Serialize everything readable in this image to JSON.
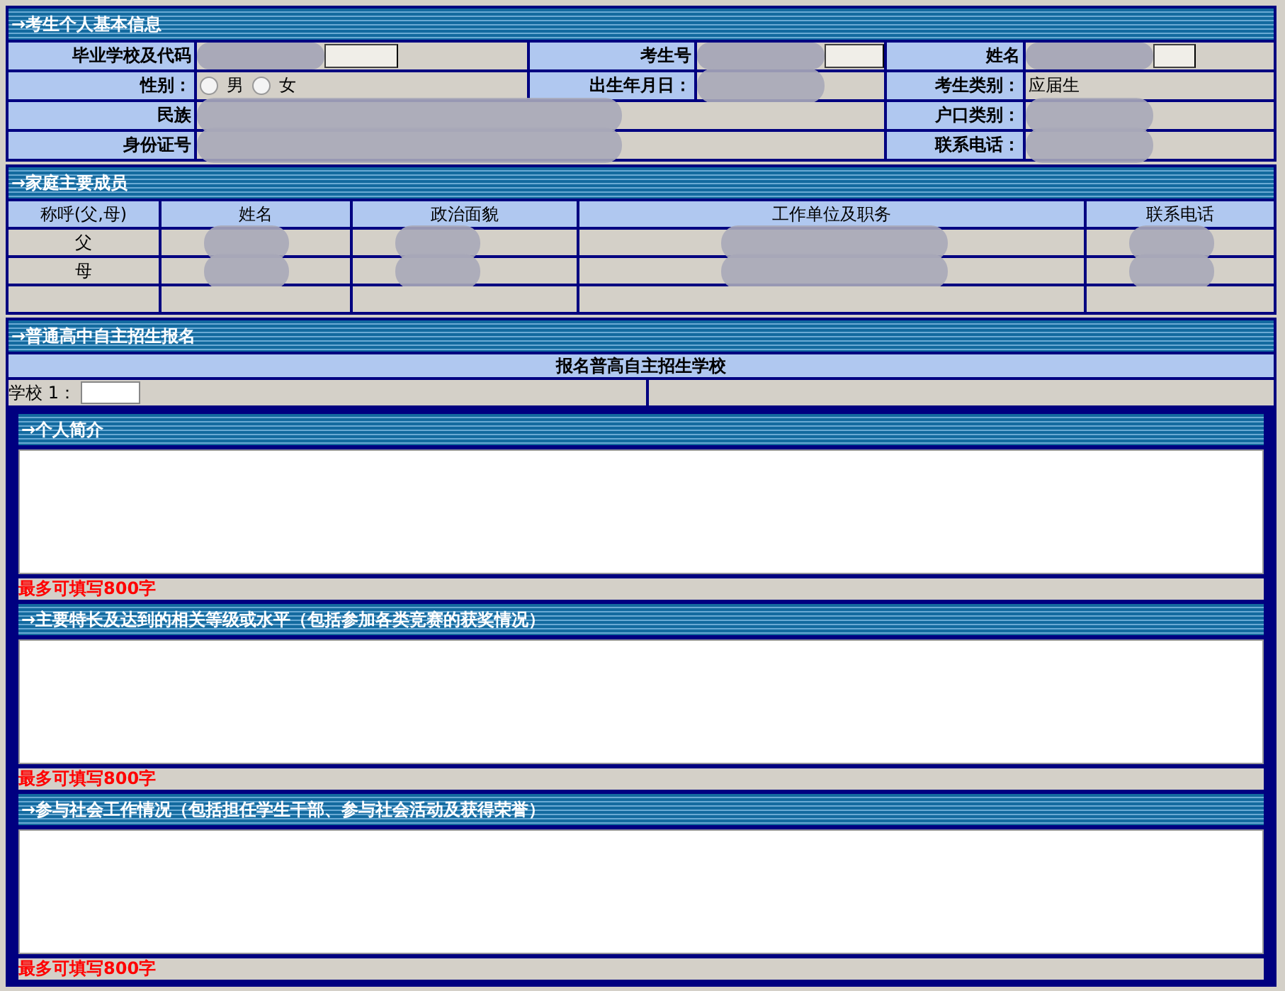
{
  "personal_info": {
    "title": "→考生个人基本信息",
    "rows": [
      {
        "cells": [
          {
            "label": "毕业学校及代码",
            "kind": "input",
            "redacted": true
          },
          {
            "label": "考生号",
            "kind": "input",
            "redacted": true
          },
          {
            "label": "姓名",
            "kind": "input",
            "redacted": true
          }
        ]
      },
      {
        "cells": [
          {
            "label": "性别：",
            "kind": "radio",
            "options": [
              {
                "label": "男",
                "selected": false
              },
              {
                "label": "女",
                "selected": false
              }
            ]
          },
          {
            "label": "出生年月日：",
            "kind": "text",
            "redacted": true
          },
          {
            "label": "考生类别：",
            "kind": "text",
            "value": "应届生"
          }
        ]
      },
      {
        "cells": [
          {
            "label": "民族",
            "kind": "wide",
            "redacted": true
          },
          {
            "label": "户口类别：",
            "kind": "text",
            "redacted": true
          }
        ]
      },
      {
        "cells": [
          {
            "label": "身份证号",
            "kind": "wide",
            "redacted": true
          },
          {
            "label": "联系电话：",
            "kind": "text",
            "redacted": true
          }
        ]
      }
    ]
  },
  "family": {
    "title": "→家庭主要成员",
    "columns": [
      "称呼(父,母)",
      "姓名",
      "政治面貌",
      "工作单位及职务",
      "联系电话"
    ],
    "rows": [
      {
        "relation": "父",
        "redacted": true
      },
      {
        "relation": "母",
        "redacted": true
      },
      {
        "relation": "",
        "redacted": false
      }
    ]
  },
  "enrollment": {
    "title": "→普通高中自主招生报名",
    "subtitle": "报名普高自主招生学校",
    "school_label": "学校 1："
  },
  "essays": [
    {
      "title": "→个人简介",
      "note": "最多可填写800字"
    },
    {
      "title": "→主要特长及达到的相关等级或水平（包括参加各类竞赛的获奖情况）",
      "note": "最多可填写800字"
    },
    {
      "title": "→参与社会工作情况（包括担任学生干部、参与社会活动及获得荣誉）",
      "note": "最多可填写800字"
    }
  ]
}
